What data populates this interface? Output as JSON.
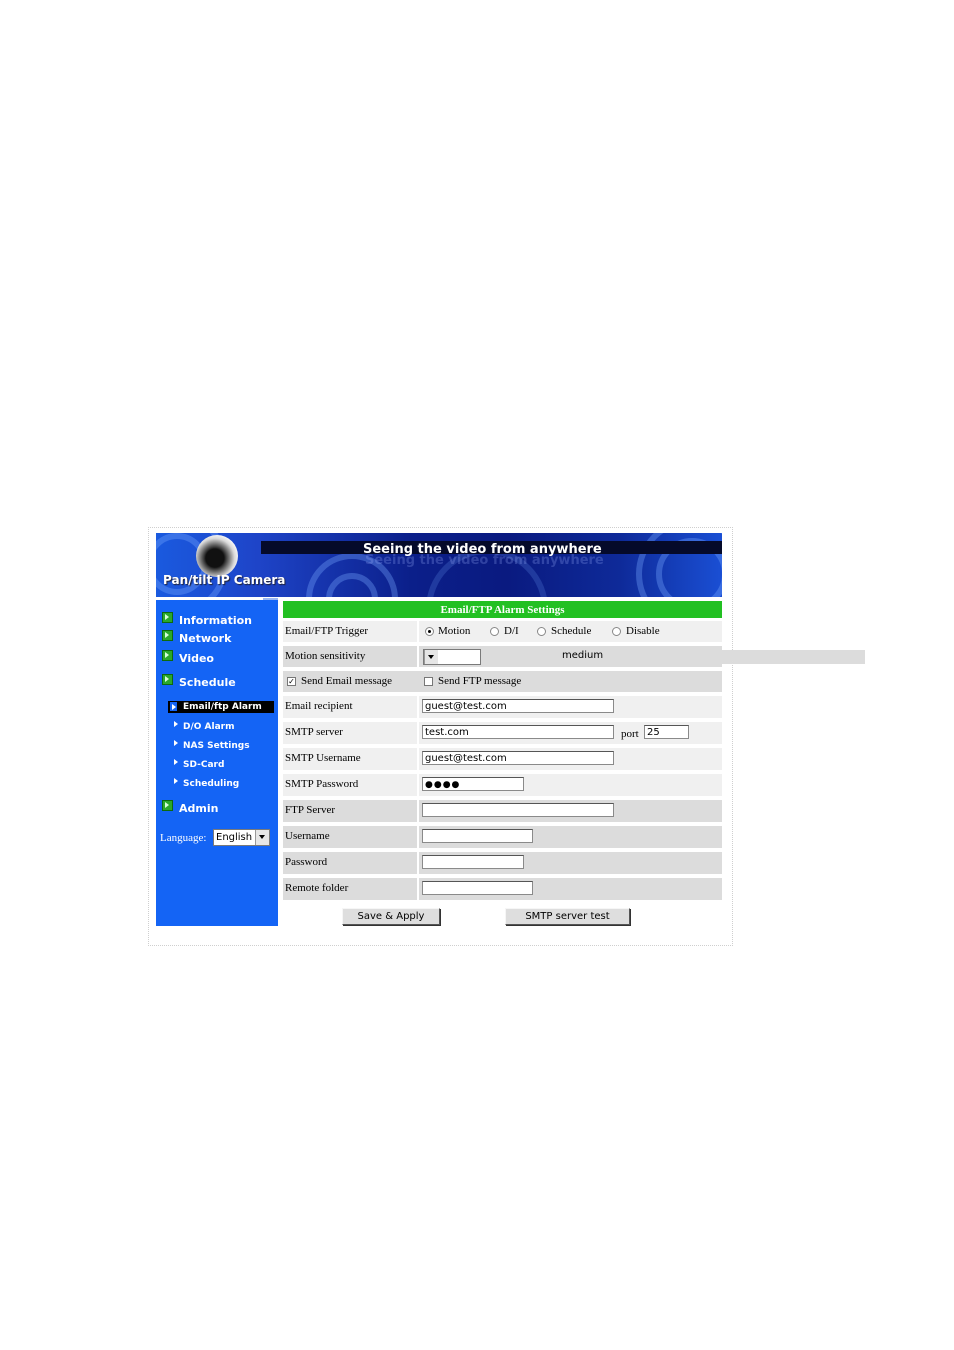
{
  "banner": {
    "title": "Seeing the video from anywhere",
    "subtitle": "Pan/tilt IP Camera"
  },
  "sidebar": {
    "main_items": [
      {
        "label": "Information"
      },
      {
        "label": "Network"
      },
      {
        "label": "Video"
      },
      {
        "label": "Schedule"
      },
      {
        "label": "Admin"
      }
    ],
    "sub_items": [
      {
        "label": "Email/ftp Alarm",
        "active": true
      },
      {
        "label": "D/O Alarm"
      },
      {
        "label": "NAS Settings"
      },
      {
        "label": "SD-Card"
      },
      {
        "label": "Scheduling"
      }
    ],
    "language_label": "Language:",
    "language_value": "English"
  },
  "form": {
    "title": "Email/FTP Alarm Settings",
    "trigger": {
      "label": "Email/FTP Trigger",
      "options": [
        "Motion",
        "D/I",
        "Schedule",
        "Disable"
      ],
      "selected": "Motion"
    },
    "motion_sensitivity": {
      "label": "Motion sensitivity",
      "value": "medium"
    },
    "send_email": {
      "label": "Send Email message",
      "checked": true
    },
    "send_ftp": {
      "label": "Send FTP message",
      "checked": false
    },
    "email_recipient": {
      "label": "Email recipient",
      "value": "guest@test.com"
    },
    "smtp_server": {
      "label": "SMTP server",
      "value": "test.com",
      "port_label": "port",
      "port_value": "25"
    },
    "smtp_username": {
      "label": "SMTP Username",
      "value": "guest@test.com"
    },
    "smtp_password": {
      "label": "SMTP Password",
      "value": "●●●●"
    },
    "ftp_server": {
      "label": "FTP Server",
      "value": ""
    },
    "username": {
      "label": "Username",
      "value": ""
    },
    "password": {
      "label": "Password",
      "value": ""
    },
    "remote_folder": {
      "label": "Remote folder",
      "value": ""
    },
    "save_button": "Save & Apply",
    "smtp_test_button": "SMTP server test"
  },
  "colors": {
    "sidebar_bg": "#1464f5",
    "header_green": "#22c022",
    "row_gray": "#dcdcdc"
  }
}
